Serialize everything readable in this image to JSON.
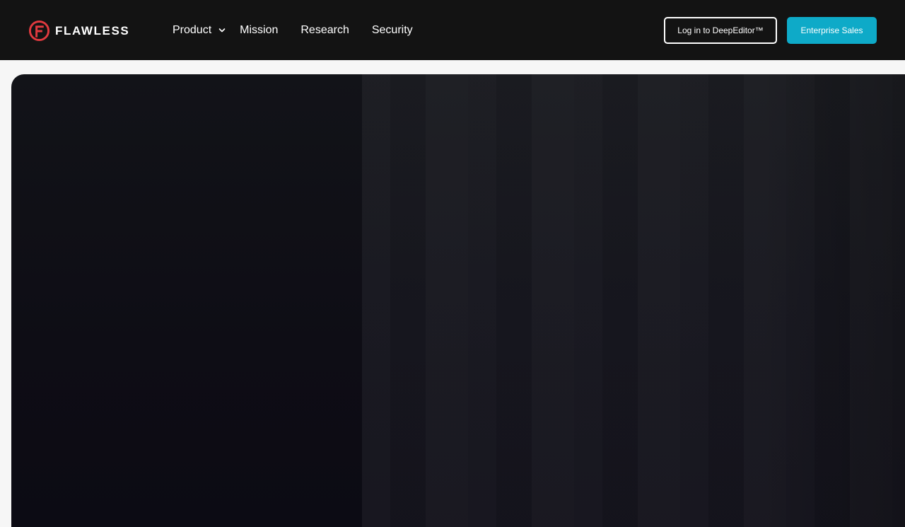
{
  "brand": {
    "name": "FLAWLESS",
    "logo_icon": "flawless-logo-icon",
    "accent_color": "#e23a3f"
  },
  "nav": {
    "items": [
      {
        "label": "Product",
        "has_dropdown": true,
        "icon": "chevron-down-icon"
      },
      {
        "label": "Mission"
      },
      {
        "label": "Research"
      },
      {
        "label": "Security"
      }
    ]
  },
  "header_actions": {
    "login_label": "Log in to DeepEditor™",
    "sales_label": "Enterprise Sales",
    "sales_color": "#0eaac8"
  },
  "colors": {
    "header_bg": "#131313",
    "page_bg": "#f6f6f6",
    "hero_bg": "#0e0d15"
  }
}
